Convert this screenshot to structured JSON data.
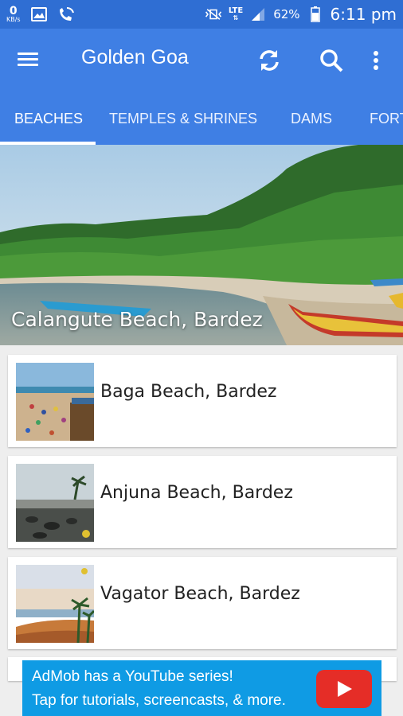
{
  "status_bar": {
    "net_speed": "0",
    "net_unit": "KB/s",
    "network": "LTE",
    "battery": "62%",
    "time": "6:11 pm"
  },
  "app_bar": {
    "title": "Golden Goa",
    "icons": [
      "menu-icon",
      "refresh-icon",
      "search-icon",
      "more-vert-icon"
    ]
  },
  "tabs": [
    {
      "label": "BEACHES",
      "active": true
    },
    {
      "label": "TEMPLES & SHRINES",
      "active": false
    },
    {
      "label": "DAMS",
      "active": false
    },
    {
      "label": "FORTS",
      "active": false
    }
  ],
  "featured": {
    "title": "Calangute Beach, Bardez"
  },
  "list": [
    {
      "title": "Baga Beach, Bardez"
    },
    {
      "title": "Anjuna Beach, Bardez"
    },
    {
      "title": "Vagator Beach, Bardez"
    }
  ],
  "ad": {
    "line1": "AdMob has a YouTube series!",
    "line2": "Tap for tutorials, screencasts, & more."
  },
  "colors": {
    "status_bar": "#2f6ed3",
    "app_bar": "#3f7fe4",
    "ad": "#0f9be4"
  }
}
